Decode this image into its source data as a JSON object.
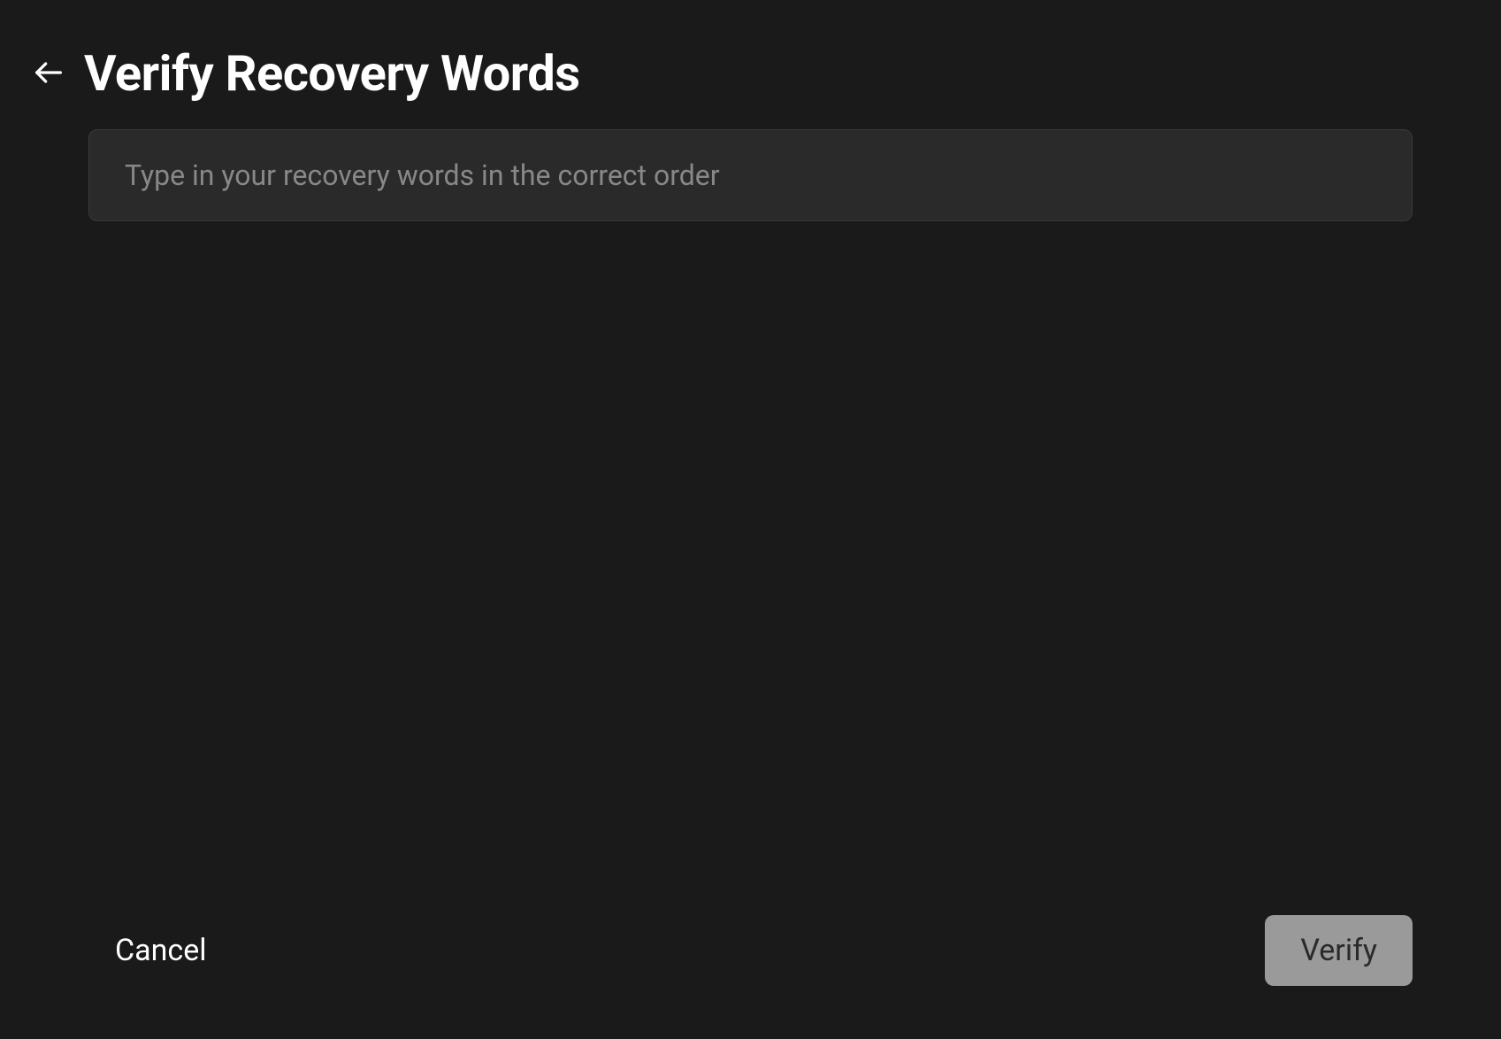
{
  "header": {
    "title": "Verify Recovery Words"
  },
  "input": {
    "placeholder": "Type in your recovery words in the correct order",
    "value": ""
  },
  "footer": {
    "cancel_label": "Cancel",
    "verify_label": "Verify"
  }
}
